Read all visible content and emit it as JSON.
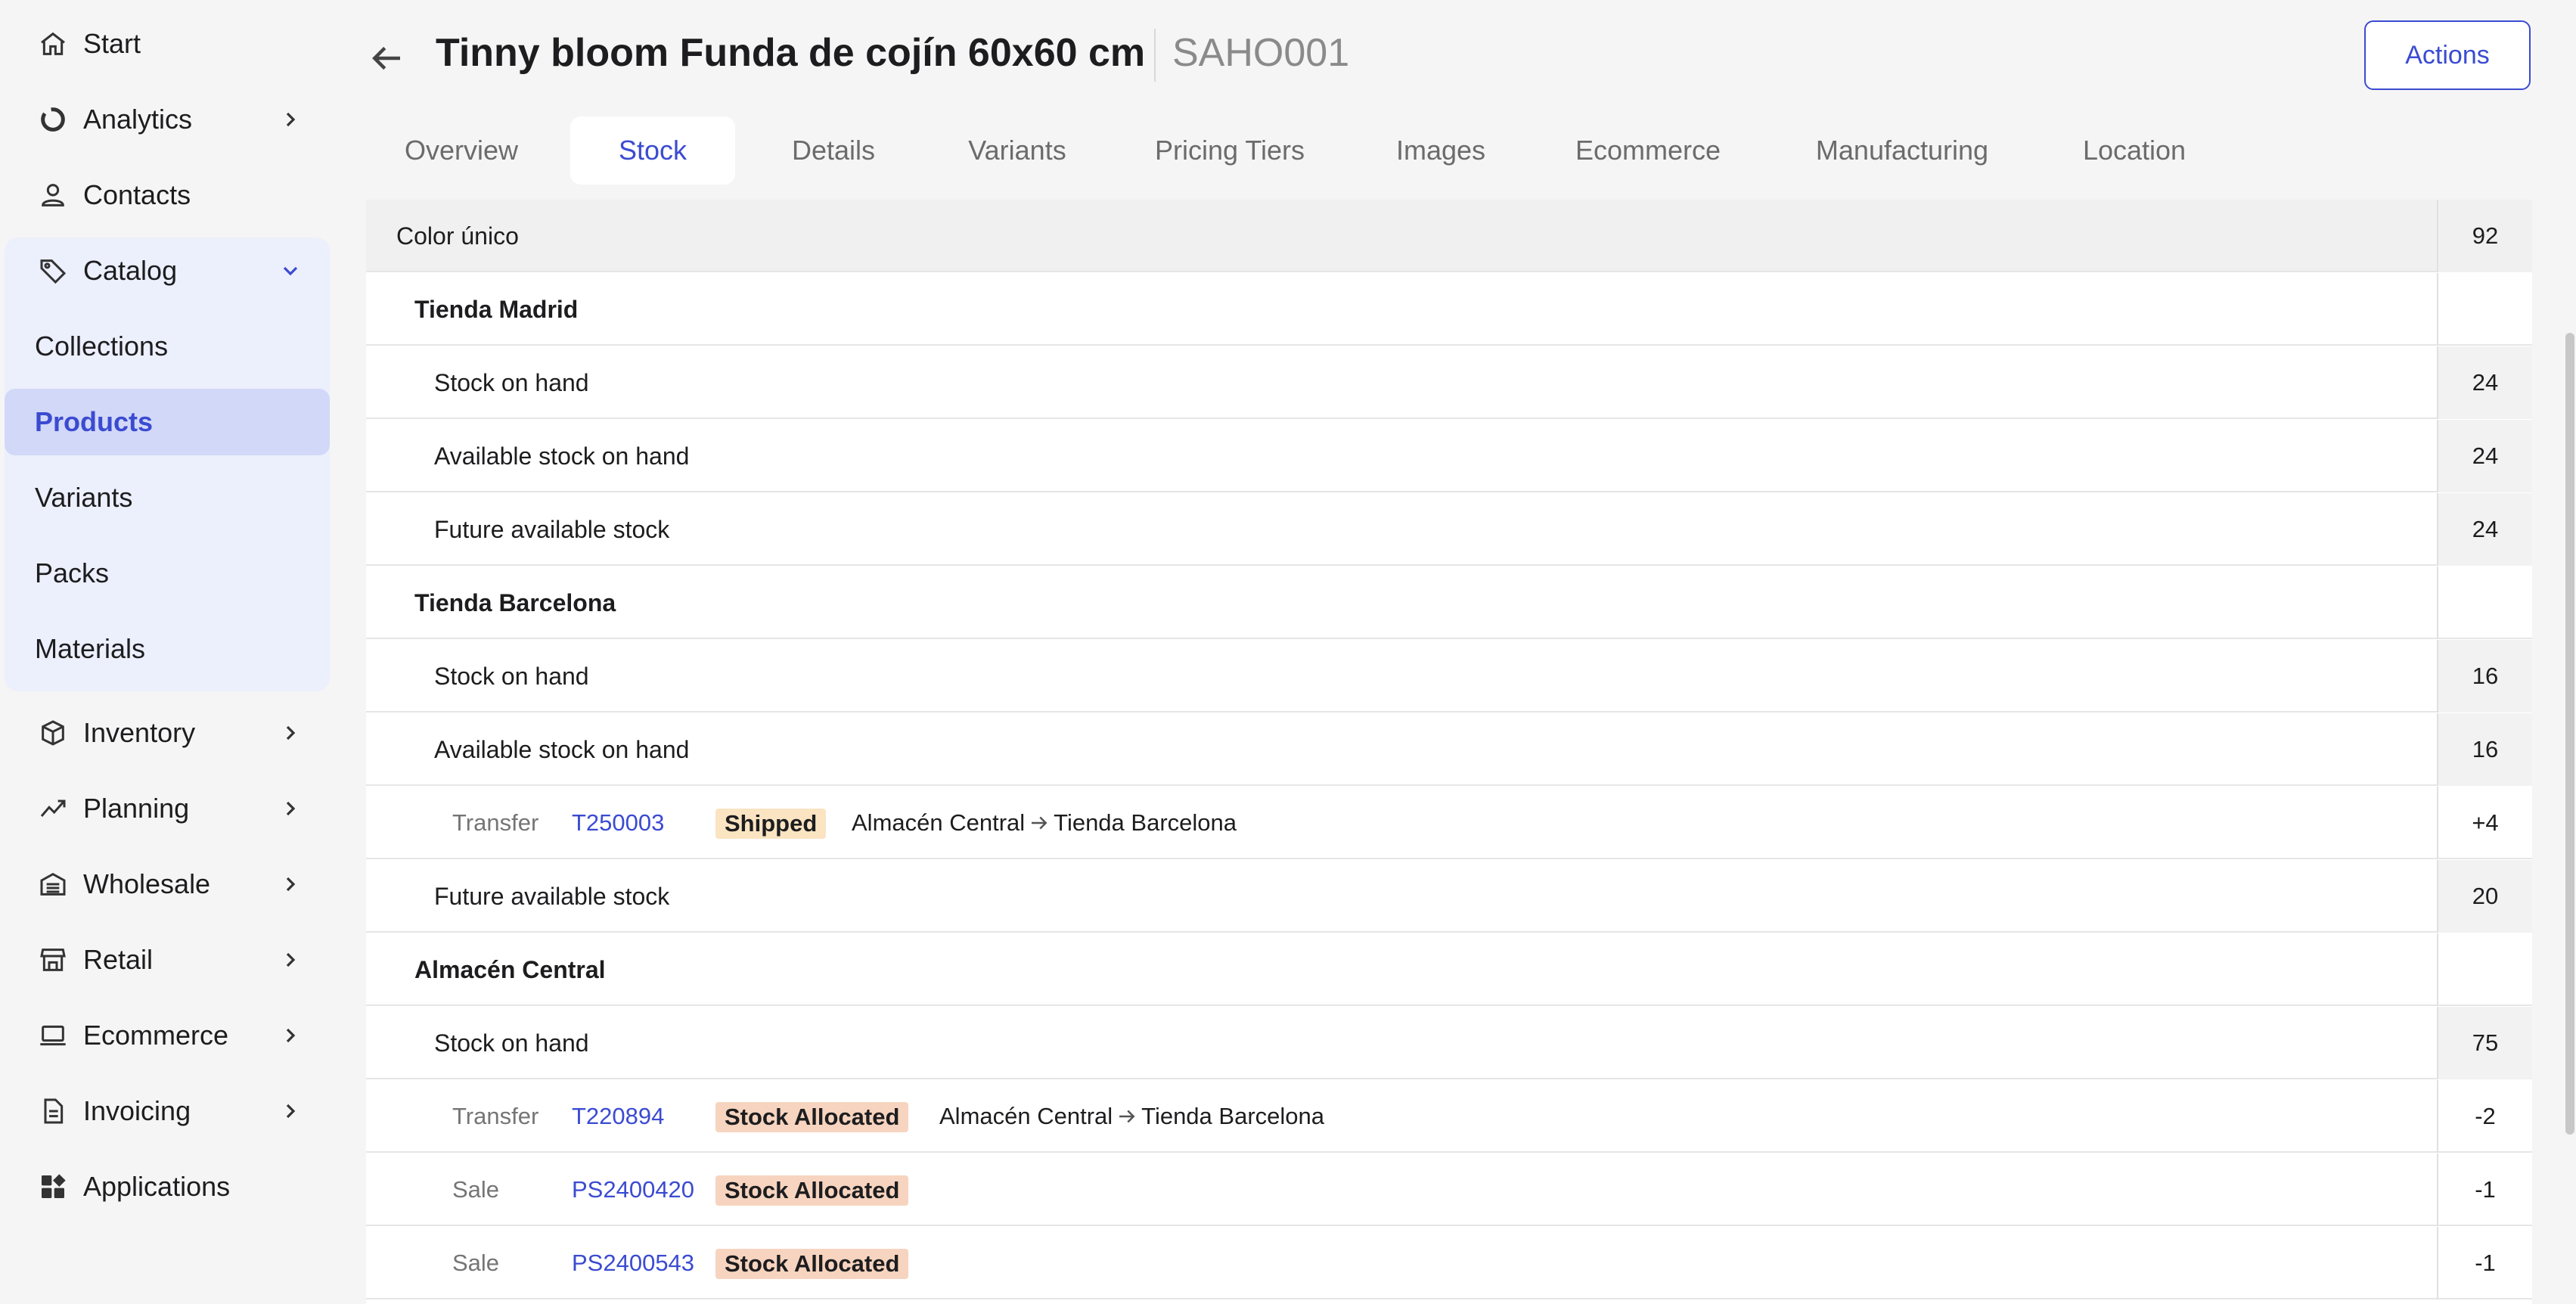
{
  "sidebar": {
    "start": "Start",
    "analytics": "Analytics",
    "contacts": "Contacts",
    "catalog": "Catalog",
    "catalog_items": [
      "Collections",
      "Products",
      "Variants",
      "Packs",
      "Materials"
    ],
    "inventory": "Inventory",
    "planning": "Planning",
    "wholesale": "Wholesale",
    "retail": "Retail",
    "ecommerce": "Ecommerce",
    "invoicing": "Invoicing",
    "applications": "Applications",
    "active_item": "Products"
  },
  "header": {
    "title": "Tinny bloom Funda de cojín 60x60 cm",
    "sku": "SAHO001",
    "actions_label": "Actions"
  },
  "tabs": [
    "Overview",
    "Stock",
    "Details",
    "Variants",
    "Pricing Tiers",
    "Images",
    "Ecommerce",
    "Manufacturing",
    "Location"
  ],
  "active_tab": "Stock",
  "stock": {
    "variant": {
      "name": "Color único",
      "total": "92"
    },
    "madrid": {
      "name": "Tienda Madrid",
      "on_hand_label": "Stock on hand",
      "on_hand": "24",
      "available_label": "Available stock on hand",
      "available": "24",
      "future_label": "Future available stock",
      "future": "24"
    },
    "barcelona": {
      "name": "Tienda Barcelona",
      "on_hand_label": "Stock on hand",
      "on_hand": "16",
      "available_label": "Available stock on hand",
      "available": "16",
      "movements": [
        {
          "type": "Transfer",
          "ref": "T250003",
          "status": "Shipped",
          "from": "Almacén Central",
          "to": "Tienda Barcelona",
          "qty": "+4"
        }
      ],
      "future_label": "Future available stock",
      "future": "20"
    },
    "central": {
      "name": "Almacén Central",
      "on_hand_label": "Stock on hand",
      "on_hand": "75",
      "movements": [
        {
          "type": "Transfer",
          "ref": "T220894",
          "status": "Stock Allocated",
          "from": "Almacén Central",
          "to": "Tienda Barcelona",
          "qty": "-2"
        },
        {
          "type": "Sale",
          "ref": "PS2400420",
          "status": "Stock Allocated",
          "qty": "-1"
        },
        {
          "type": "Sale",
          "ref": "PS2400543",
          "status": "Stock Allocated",
          "qty": "-1"
        }
      ]
    }
  }
}
